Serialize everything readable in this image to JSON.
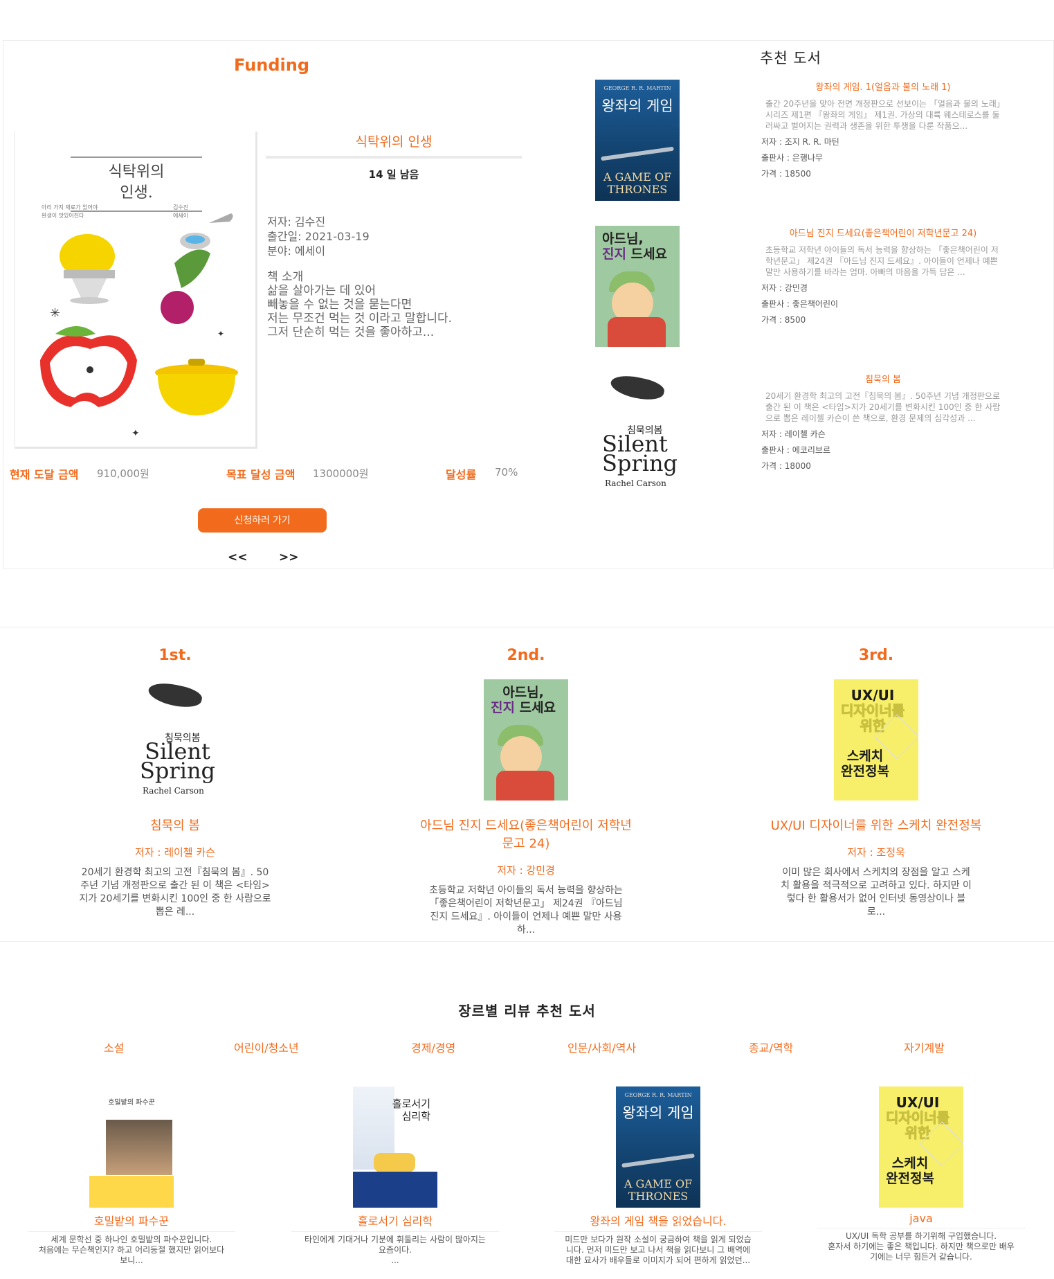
{
  "funding": {
    "heading": "Funding",
    "book": {
      "cover_title": "식탁위의\n인생.",
      "cover_sub": "아리 가지 재료가 있어야\n완생이 맛있어진다",
      "cover_sub2": "김수진\n에세이",
      "title": "식탁위의 인생",
      "days_left": "14 일 남음",
      "author": "저자: 김수진",
      "published": "출간일: 2021-03-19",
      "genre": "분야: 에세이",
      "intro_label": "책 소개",
      "intro_lines": [
        "삶을 살아가는 데 있어",
        "빼놓을 수 없는 것을 묻는다면",
        "저는 무조건 먹는 것 이라고 말합니다.",
        "그저 단순히 먹는 것을 좋아하고..."
      ]
    },
    "stats": {
      "current_label": "현재 도달 금액",
      "current_value": "910,000원",
      "target_label": "목표 달성 금액",
      "target_value": "1300000원",
      "rate_label": "달성률",
      "rate_value": "70%",
      "progress": 0.7
    },
    "apply_button": "신청하러 가기",
    "prev": "<<",
    "next": ">>"
  },
  "recommended": {
    "heading": "추천 도서",
    "items": [
      {
        "title": "왕좌의 게임. 1(얼음과 불의 노래 1)",
        "desc": "출간 20주년을 맞아 전면 개정판으로 선보이는 「얼음과 불의 노래」 시리즈 제1편 『왕좌의 게임』 제1권. 가상의 대륙 웨스테로스를 둘러싸고 벌어지는 권력과 생존을 위한 투쟁을 다룬 작품으...",
        "author": "저자 : 조지 R. R. 마틴",
        "publisher": "출판사 : 은행나무",
        "price": "가격 : 18500",
        "cover": {
          "author": "GEORGE R. R. MARTIN",
          "title": "왕좌의 게임",
          "en": "A GAME OF THRONES"
        }
      },
      {
        "title": "아드님 진지 드세요(좋은책어린이 저학년문고 24)",
        "desc": "초등학교 저학년 아이들의 독서 능력을 향상하는 「좋은책어린이 저학년문고」 제24권 『아드님 진지 드세요』. 아이들이 언제나 예쁜 말만 사용하기를 바라는 엄마. 아빠의 마음을 가득 담은 ...",
        "author": "저자 : 강민경",
        "publisher": "출판사 : 좋은책어린이",
        "price": "가격 : 8500",
        "cover": {
          "title_a": "아드님,",
          "title_b": "진지",
          "title_c": "드세요"
        }
      },
      {
        "title": "침묵의 봄",
        "desc": "20세기 환경학 최고의 고전『침묵의 봄』. 50주년 기념 개정판으로 출간 된 이 책은 <타임>지가 20세기를 변화시킨 100인 중 한 사람으로 뽑은 레이첼 카슨이 쓴 책으로, 환경 문제의 심각성과 ...",
        "author": "저자 : 레이첼 카슨",
        "publisher": "출판사 : 에코리브르",
        "price": "가격 : 18000",
        "cover": {
          "kr": "침묵의봄",
          "en": "Silent\nSpring",
          "author": "Rachel Carson"
        }
      }
    ]
  },
  "ranking": [
    {
      "rank": "1st.",
      "title": "침묵의 봄",
      "author": "저자 : 레이첼 카슨",
      "desc": "20세기 환경학 최고의 고전『침묵의 봄』. 50주년 기념 개정판으로 출간 된 이 책은 <타임>지가 20세기를 변화시킨 100인 중 한 사람으로 뽑은 레..."
    },
    {
      "rank": "2nd.",
      "title": "아드님 진지 드세요(좋은책어린이 저학년문고 24)",
      "author": "저자 : 강민경",
      "desc": "초등학교 저학년 아이들의 독서 능력을 향상하는 「좋은책어린이 저학년문고」 제24권 『아드님 진지 드세요』. 아이들이 언제나 예쁜 말만 사용하..."
    },
    {
      "rank": "3rd.",
      "title": "UX/UI 디자이너를 위한 스케치 완전정복",
      "author": "저자 : 조정욱",
      "desc": "이미 많은 회사에서 스케치의 장점을 알고 스케치 활용을 적극적으로 고려하고 있다. 하지만 이렇다 한 활용서가 없어 인터넷 동영상이나 블로...",
      "cover": {
        "a": "UX/UI",
        "b": "디자이너를",
        "c": "위한",
        "d": "스케치",
        "e": "완전정복"
      }
    }
  ],
  "genre": {
    "heading": "장르별 리뷰 추천 도서",
    "tabs": [
      "소설",
      "어린이/청소년",
      "경제/경영",
      "인문/사회/역사",
      "종교/역학",
      "자기계발"
    ],
    "cards": [
      {
        "title": "호밀밭의 파수꾼",
        "desc": "세계 문학선 중 하나인 호밀밭의 파수꾼입니다.\n처음에는 무슨책인지? 하고 어리둥절 했지만 읽어보다\n보니...",
        "cover_title": "호밀밭의 파수꾼"
      },
      {
        "title": "홀로서기 심리학",
        "desc": "타인에게 기대거나 기분에 휘둘리는 사람이 많아지는\n요즘이다.\n...",
        "cover_title": "홀로서기\n심리학"
      },
      {
        "title": "왕좌의 게임 책을 읽었습니다.",
        "desc": "미드만 보다가 원작 소설이 궁금하여 책을 읽게 되었습\n니다. 먼저 미드만 보고 나서 책을 읽다보니 그 배역에\n대한 묘사가 배우들로 이미지가 되어 편하게 읽었던..."
      },
      {
        "title": "java",
        "desc": "UX/UI 독학 공부를 하기위해 구입했습니다.\n혼자서 하기에는 좋은 책입니다. 하지만 책으로만 배우\n기에는 너무 힘든거 같습니다."
      }
    ]
  }
}
